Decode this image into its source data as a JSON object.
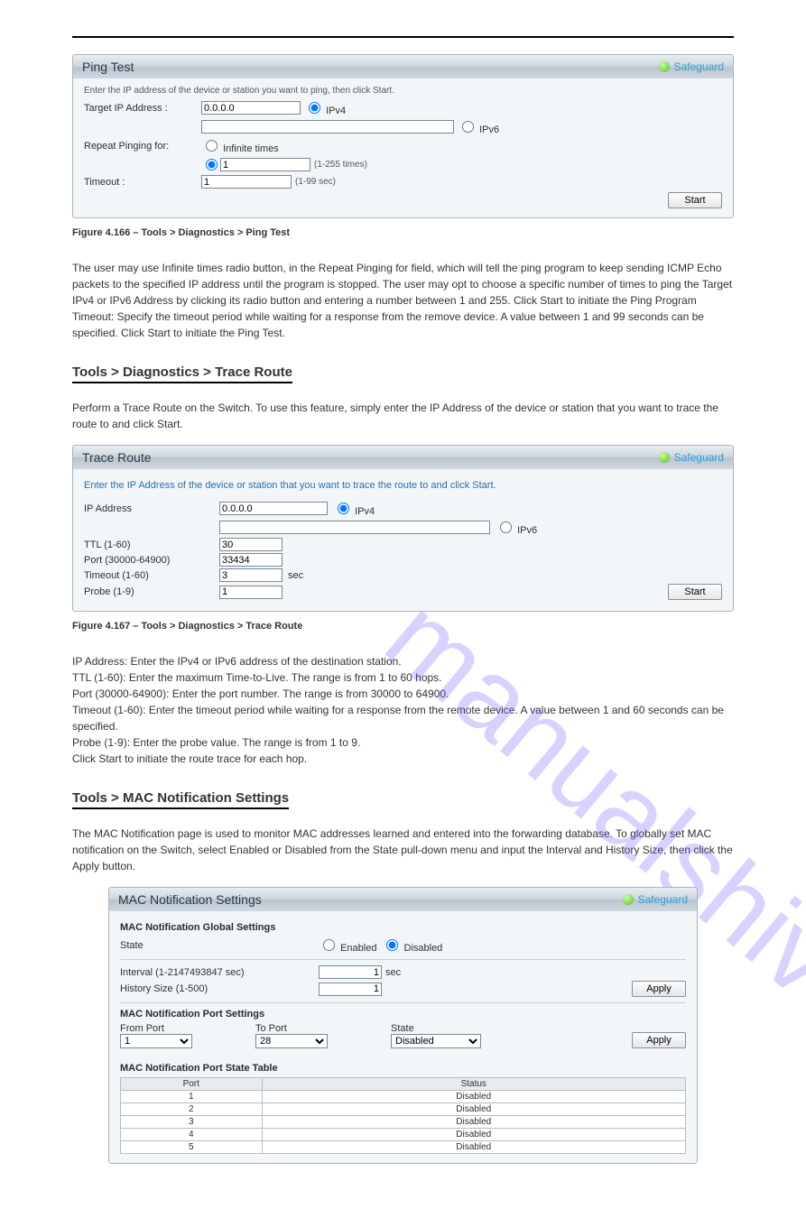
{
  "watermark": "manualshive.com",
  "safeguard_label": "Safeguard",
  "ping": {
    "title": "Ping Test",
    "instruction": "Enter the IP address of the device or station you want to ping, then click Start.",
    "lbl_target": "Target IP Address :",
    "val_ipv4": "0.0.0.0",
    "opt_ipv4": "IPv4",
    "opt_ipv6": "IPv6",
    "lbl_repeat": "Repeat Pinging for:",
    "opt_infinite": "Infinite times",
    "val_times": "1",
    "hint_times": "(1-255 times)",
    "lbl_timeout": "Timeout :",
    "val_timeout": "1",
    "hint_timeout": "(1-99 sec)",
    "btn_start": "Start"
  },
  "ping_caption": "Figure 4.166 – Tools > Diagnostics > Ping Test",
  "ping_body": "The user may use Infinite times radio button, in the Repeat Pinging for field, which will tell the ping program to keep sending ICMP Echo packets to the specified IP address until the program is stopped. The user may opt to choose a specific number of times to ping the Target IPv4 or IPv6 Address by clicking its radio button and entering a number between 1 and 255. Click Start to initiate the Ping Program Timeout: Specify the timeout period while waiting for a response from the remove device. A value between 1 and 99 seconds can be specified. Click Start to initiate the Ping Test.",
  "tr_head": "Tools > Diagnostics > Trace Route",
  "tr_lead": "Perform a Trace Route on the Switch. To use this feature, simply enter the IP Address of the device or station that you want to trace the route to and click Start.",
  "trace": {
    "title": "Trace Route",
    "instruction": "Enter the IP Address of the device or station that you want to trace the route to and click Start.",
    "lbl_ip": "IP Address",
    "val_ip": "0.0.0.0",
    "opt_ipv4": "IPv4",
    "opt_ipv6": "IPv6",
    "lbl_ttl": "TTL (1-60)",
    "val_ttl": "30",
    "lbl_port": "Port (30000-64900)",
    "val_port": "33434",
    "lbl_timeout": "Timeout (1-60)",
    "val_timeout": "3",
    "timeout_unit": "sec",
    "lbl_probe": "Probe (1-9)",
    "val_probe": "1",
    "btn_start": "Start"
  },
  "tr_caption": "Figure 4.167 – Tools > Diagnostics > Trace Route",
  "tr_body": "IP Address: Enter the IPv4 or IPv6 address of the destination station.\nTTL (1-60): Enter the maximum Time-to-Live. The range is from 1 to 60 hops.\nPort (30000-64900): Enter the port number. The range is from 30000 to 64900.\nTimeout (1-60): Enter the timeout period while waiting for a response from the remote device. A value between 1 and 60 seconds can be specified.\nProbe (1-9): Enter the probe value. The range is from 1 to 9.\nClick Start to initiate the route trace for each hop.",
  "mac_head": "Tools > MAC Notification Settings",
  "mac_lead": "The MAC Notification page is used to monitor MAC addresses learned and entered into the forwarding database. To globally set MAC notification on the Switch, select Enabled or Disabled from the State pull-down menu and input the Interval and History Size, then click the Apply button.",
  "mac": {
    "title": "MAC Notification Settings",
    "section_global": "MAC Notification Global Settings",
    "lbl_state": "State",
    "opt_enabled": "Enabled",
    "opt_disabled": "Disabled",
    "lbl_interval": "Interval (1-2147493847 sec)",
    "val_interval": "1",
    "interval_unit": "sec",
    "lbl_history": "History Size (1-500)",
    "val_history": "1",
    "btn_apply": "Apply",
    "section_port": "MAC Notification Port Settings",
    "lbl_from": "From Port",
    "val_from": "1",
    "lbl_to": "To Port",
    "val_to": "28",
    "lbl_pstate": "State",
    "val_pstate": "Disabled",
    "section_table": "MAC Notification Port State Table",
    "col_port": "Port",
    "col_status": "Status",
    "rows": [
      {
        "port": "1",
        "status": "Disabled"
      },
      {
        "port": "2",
        "status": "Disabled"
      },
      {
        "port": "3",
        "status": "Disabled"
      },
      {
        "port": "4",
        "status": "Disabled"
      },
      {
        "port": "5",
        "status": "Disabled"
      }
    ]
  }
}
